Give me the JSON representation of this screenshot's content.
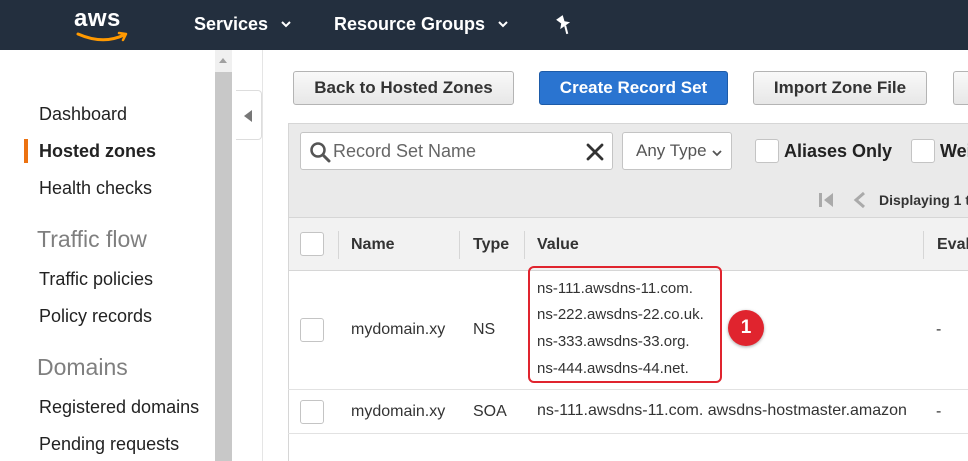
{
  "topbar": {
    "logo_text": "aws",
    "nav": [
      {
        "label": "Services"
      },
      {
        "label": "Resource Groups"
      }
    ]
  },
  "sidebar": {
    "items": [
      {
        "label": "Dashboard",
        "active": false
      },
      {
        "label": "Hosted zones",
        "active": true
      },
      {
        "label": "Health checks",
        "active": false
      }
    ],
    "sections": [
      {
        "title": "Traffic flow",
        "items": [
          {
            "label": "Traffic policies"
          },
          {
            "label": "Policy records"
          }
        ]
      },
      {
        "title": "Domains",
        "items": [
          {
            "label": "Registered domains"
          },
          {
            "label": "Pending requests"
          }
        ]
      }
    ]
  },
  "toolbar": {
    "back_label": "Back to Hosted Zones",
    "create_label": "Create Record Set",
    "import_label": "Import Zone File"
  },
  "filters": {
    "search_placeholder": "Record Set Name",
    "type_select": "Any Type",
    "aliases_only_label": "Aliases Only",
    "weighted_label": "Wei",
    "pager_text": "Displaying 1 t"
  },
  "table": {
    "columns": [
      "Name",
      "Type",
      "Value",
      "Eval"
    ],
    "rows": [
      {
        "name": "mydomain.xy",
        "type": "NS",
        "values": [
          "ns-111.awsdns-11.com.",
          "ns-222.awsdns-22.co.uk.",
          "ns-333.awsdns-33.org.",
          "ns-444.awsdns-44.net."
        ],
        "eval": "-"
      },
      {
        "name": "mydomain.xy",
        "type": "SOA",
        "values": [
          "ns-111.awsdns-11.com. awsdns-hostmaster.amazon"
        ],
        "eval": "-"
      }
    ]
  },
  "annotation": {
    "badge": "1"
  },
  "colors": {
    "topbar": "#232f3e",
    "primary_button": "#2a74d0",
    "active_indicator": "#ec7211",
    "annotation_red": "#e0242e"
  }
}
